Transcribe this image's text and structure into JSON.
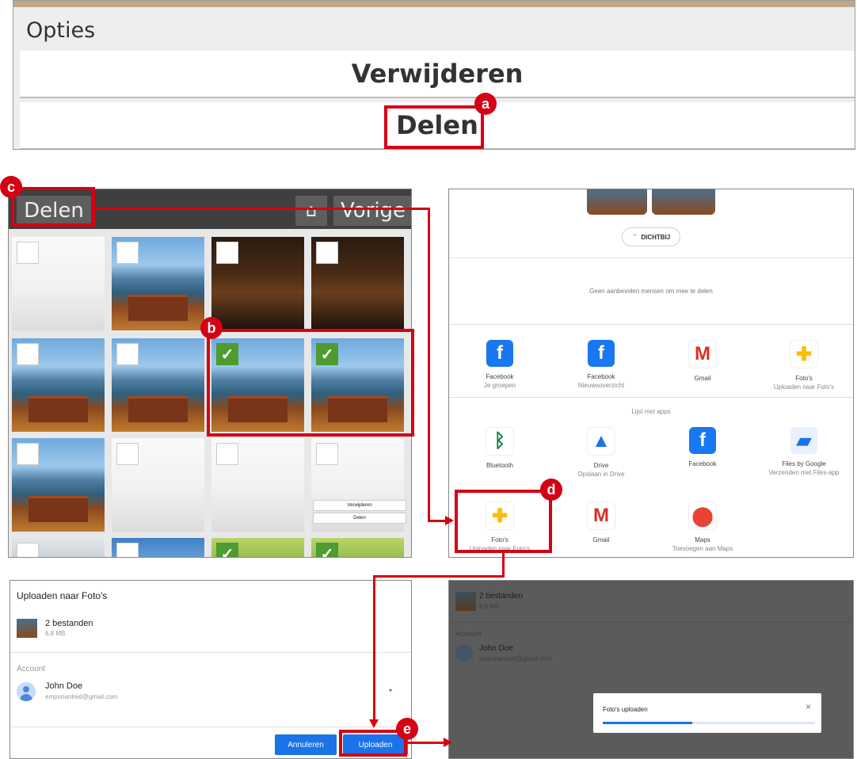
{
  "panel_a": {
    "section_label": "Opties",
    "delete_label": "Verwijderen",
    "share_label": "Delen",
    "badge": "a"
  },
  "panel_b": {
    "share_label": "Delen",
    "home_icon": "home-icon",
    "back_label": "Vorige",
    "badge_selected": "b",
    "badge_share": "c",
    "mini_menu": {
      "delete": "Verwijderen",
      "share": "Delen"
    }
  },
  "panel_c": {
    "nearby_label": "DICHTBIJ",
    "no_people_text": "Geen aanbevolen mensen om mee te delen",
    "top_apps": [
      {
        "name": "Facebook",
        "sub": "Je groepen",
        "icon": "facebook-icon"
      },
      {
        "name": "Facebook",
        "sub": "Nieuwsoverzicht",
        "icon": "facebook-icon"
      },
      {
        "name": "Gmail",
        "sub": "",
        "icon": "gmail-icon"
      },
      {
        "name": "Foto's",
        "sub": "Uploaden naar Foto's",
        "icon": "google-photos-icon"
      }
    ],
    "apps_list_label": "Lijst met apps",
    "apps_row1": [
      {
        "name": "Bluetooth",
        "sub": "",
        "icon": "bluetooth-icon"
      },
      {
        "name": "Drive",
        "sub": "Opslaan in Drive",
        "icon": "google-drive-icon"
      },
      {
        "name": "Facebook",
        "sub": "",
        "icon": "facebook-icon"
      },
      {
        "name": "Files by Google",
        "sub": "Verzenden met Files-app",
        "icon": "files-by-google-icon"
      }
    ],
    "apps_row2": [
      {
        "name": "Foto's",
        "sub": "Uploaden naar Foto's",
        "icon": "google-photos-icon"
      },
      {
        "name": "Gmail",
        "sub": "",
        "icon": "gmail-icon"
      },
      {
        "name": "Maps",
        "sub": "Toevoegen aan Maps",
        "icon": "google-maps-icon"
      }
    ],
    "badge": "d"
  },
  "panel_d": {
    "title": "Uploaden naar Foto's",
    "files_label": "2 bestanden",
    "files_size": "6,8 MB",
    "account_label": "Account",
    "account_name": "John Doe",
    "account_email": "emporianlred@gmail.com",
    "cancel_label": "Annuleren",
    "upload_label": "Uploaden",
    "badge": "e"
  },
  "panel_e": {
    "files_label": "2 bestanden",
    "files_size": "6,8 MB",
    "account_label": "Account",
    "account_name": "John Doe",
    "account_email": "emporianlred@gmail.com",
    "toast_title": "Foto's uploaden",
    "upload_progress": 0.42
  },
  "colors": {
    "annotation_red": "#d60014",
    "google_blue": "#1a73e8",
    "checkbox_green": "#4e9b2f"
  }
}
